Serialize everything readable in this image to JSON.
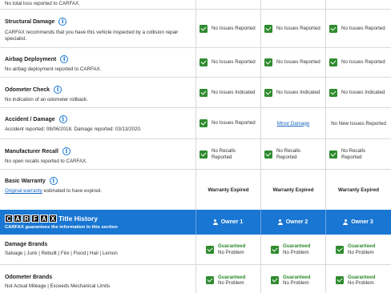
{
  "top_row": {
    "desc": "No total loss reported to CARFAX."
  },
  "rows": [
    {
      "title": "Structural Damage",
      "desc": "CARFAX recommends that you have this vehicle inspected by a collision repair specialist.",
      "o1": "No Issues Reported",
      "o2": "No Issues Reported",
      "o3": "No Issues Reported"
    },
    {
      "title": "Airbag Deployment",
      "desc": "No airbag deployment reported to CARFAX.",
      "o1": "No Issues Reported",
      "o2": "No Issues Reported",
      "o3": "No Issues Reported"
    },
    {
      "title": "Odometer Check",
      "desc": "No indication of an odometer rollback.",
      "o1": "No Issues Indicated",
      "o2": "No Issues Indicated",
      "o3": "No Issues Indicated"
    },
    {
      "title": "Accident / Damage",
      "desc": "Accident reported: 08/06/2018. Damage reported: 03/13/2020.",
      "o1": "No Issues Reported",
      "o2": "Minor Damage",
      "o3": "No New Issues Reported"
    },
    {
      "title": "Manufacturer Recall",
      "desc": "No open recalls reported to CARFAX.",
      "o1": "No Recalls Reported",
      "o2": "No Recalls Reported",
      "o3": "No Recalls Reported"
    },
    {
      "title": "Basic Warranty",
      "desc_link": "Original warranty",
      "desc_rest": " estimated to have expired.",
      "o1": "Warranty Expired",
      "o2": "Warranty Expired",
      "o3": "Warranty Expired"
    }
  ],
  "title_history": {
    "logo_letters": [
      "C",
      "A",
      "R",
      "F",
      "A",
      "X"
    ],
    "title": "Title History",
    "subtitle": "CARFAX guarantees the information in this section",
    "owners": [
      "Owner 1",
      "Owner 2",
      "Owner 3"
    ]
  },
  "title_rows": [
    {
      "title": "Damage Brands",
      "desc": "Salvage | Junk | Rebuilt | Fire | Flood | Hail | Lemon",
      "status_top": "Guaranteed",
      "status_bottom": "No Problem"
    },
    {
      "title": "Odometer Brands",
      "desc": "Not Actual Mileage | Exceeds Mechanical Limits",
      "status_top": "Guaranteed",
      "status_bottom": "No Problem"
    }
  ],
  "colors": {
    "accent": "#1976d2",
    "check": "#2e8b2e",
    "link": "#1565c0"
  }
}
